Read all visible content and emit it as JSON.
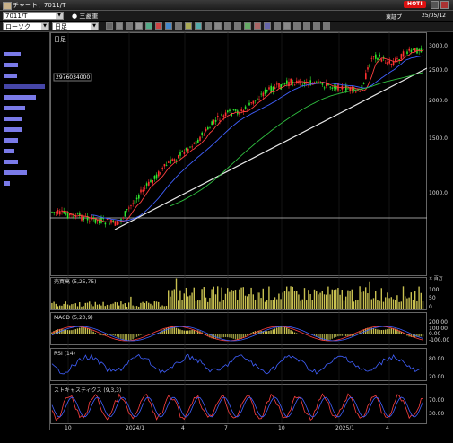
{
  "window": {
    "title": "チャート：7011/T",
    "hot_badge": "HOT!"
  },
  "toolbar": {
    "code_value": "7011/T",
    "stock_name": "● 三菱重",
    "market": "東証プ",
    "date": "25/05/12",
    "chart_type": "ローソク",
    "period": "日足"
  },
  "chart": {
    "period_label": "日足",
    "price_callout": "2976034000",
    "price_ticks": [
      "3000.0",
      "2500.0",
      "2000.0",
      "1500.0",
      "1000.0"
    ],
    "volume_panel": {
      "label": "売買高 (5,25,75)",
      "unit": "× 百万",
      "ticks": [
        "100",
        "50",
        "0"
      ]
    },
    "macd_panel": {
      "label": "MACD (5,20,9)",
      "ticks": [
        "200.00",
        "100.00",
        "0.00",
        "-100.00"
      ]
    },
    "rsi_panel": {
      "label": "RSI (14)",
      "ticks": [
        "80.00",
        "20.00"
      ]
    },
    "stoch_panel": {
      "label": "ストキャスティクス (9,3,3)",
      "ticks": [
        "70.00",
        "30.00"
      ]
    },
    "x_ticks": [
      "10",
      "2024/1",
      "4",
      "7",
      "10",
      "2025/1",
      "4"
    ]
  },
  "colors": {
    "up": "#ff3030",
    "down": "#2ee62e",
    "ma_short": "#ff4040",
    "ma_mid": "#4060ff",
    "ma_long": "#30c040",
    "trend": "#e8e8e8"
  },
  "volume_profile": [
    0.35,
    0.3,
    0.28,
    0.9,
    0.7,
    0.45,
    0.4,
    0.38,
    0.3,
    0.22,
    0.3,
    0.5,
    0.12
  ]
}
